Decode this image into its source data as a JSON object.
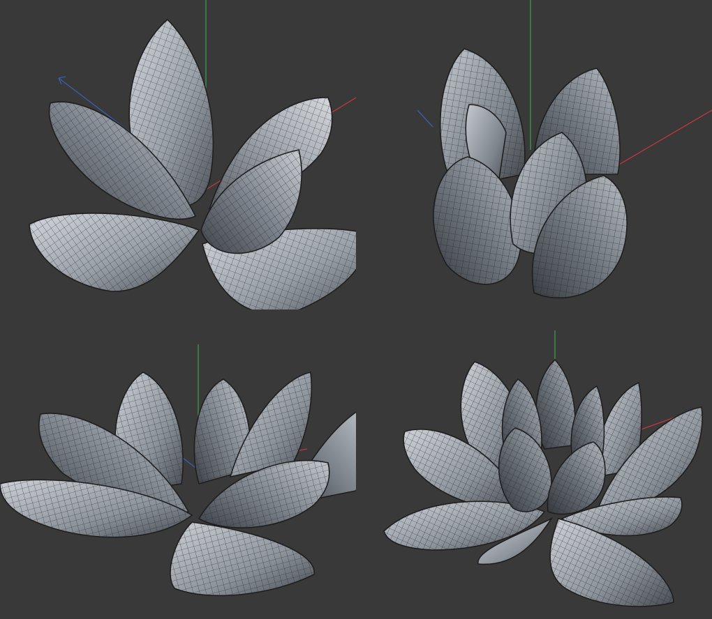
{
  "viewports": [
    {
      "id": "top-left",
      "axes": [
        "x",
        "y",
        "z"
      ]
    },
    {
      "id": "top-right",
      "axes": [
        "x",
        "y",
        "z"
      ]
    },
    {
      "id": "bottom-left",
      "axes": [
        "x",
        "y",
        "z"
      ]
    },
    {
      "id": "bottom-right",
      "axes": [
        "x",
        "y",
        "z"
      ]
    }
  ],
  "colors": {
    "background": "#3a3a3a",
    "mesh_light": "#c3c8cf",
    "mesh_mid": "#8a9099",
    "mesh_dark": "#4d525a",
    "wire": "#2a2c2f",
    "axis_x": "#c0393b",
    "axis_y": "#3a9a4a",
    "axis_z": "#3b5fb0"
  }
}
